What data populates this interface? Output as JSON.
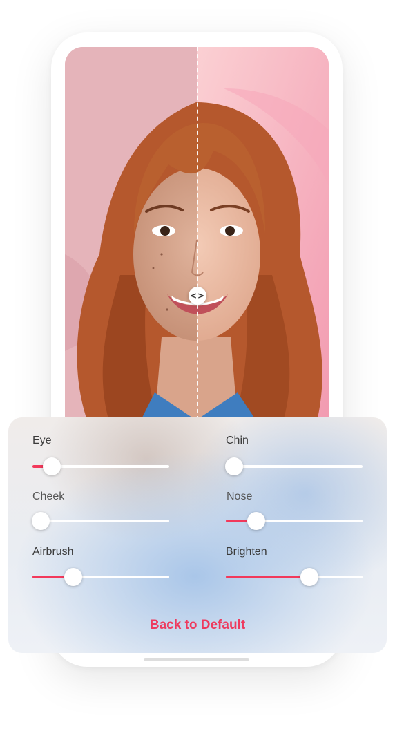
{
  "colors": {
    "accent": "#f2395b",
    "track": "#ffffff",
    "thumb": "#ffffff"
  },
  "photo": {
    "compare_icon": "<>"
  },
  "sliders": [
    {
      "id": "eye",
      "label": "Eye",
      "value": 0.14
    },
    {
      "id": "chin",
      "label": "Chin",
      "value": 0.06
    },
    {
      "id": "cheek",
      "label": "Cheek",
      "value": 0.06
    },
    {
      "id": "nose",
      "label": "Nose",
      "value": 0.22
    },
    {
      "id": "airbrush",
      "label": "Airbrush",
      "value": 0.3
    },
    {
      "id": "brighten",
      "label": "Brighten",
      "value": 0.61
    }
  ],
  "reset_button": "Back to Default"
}
